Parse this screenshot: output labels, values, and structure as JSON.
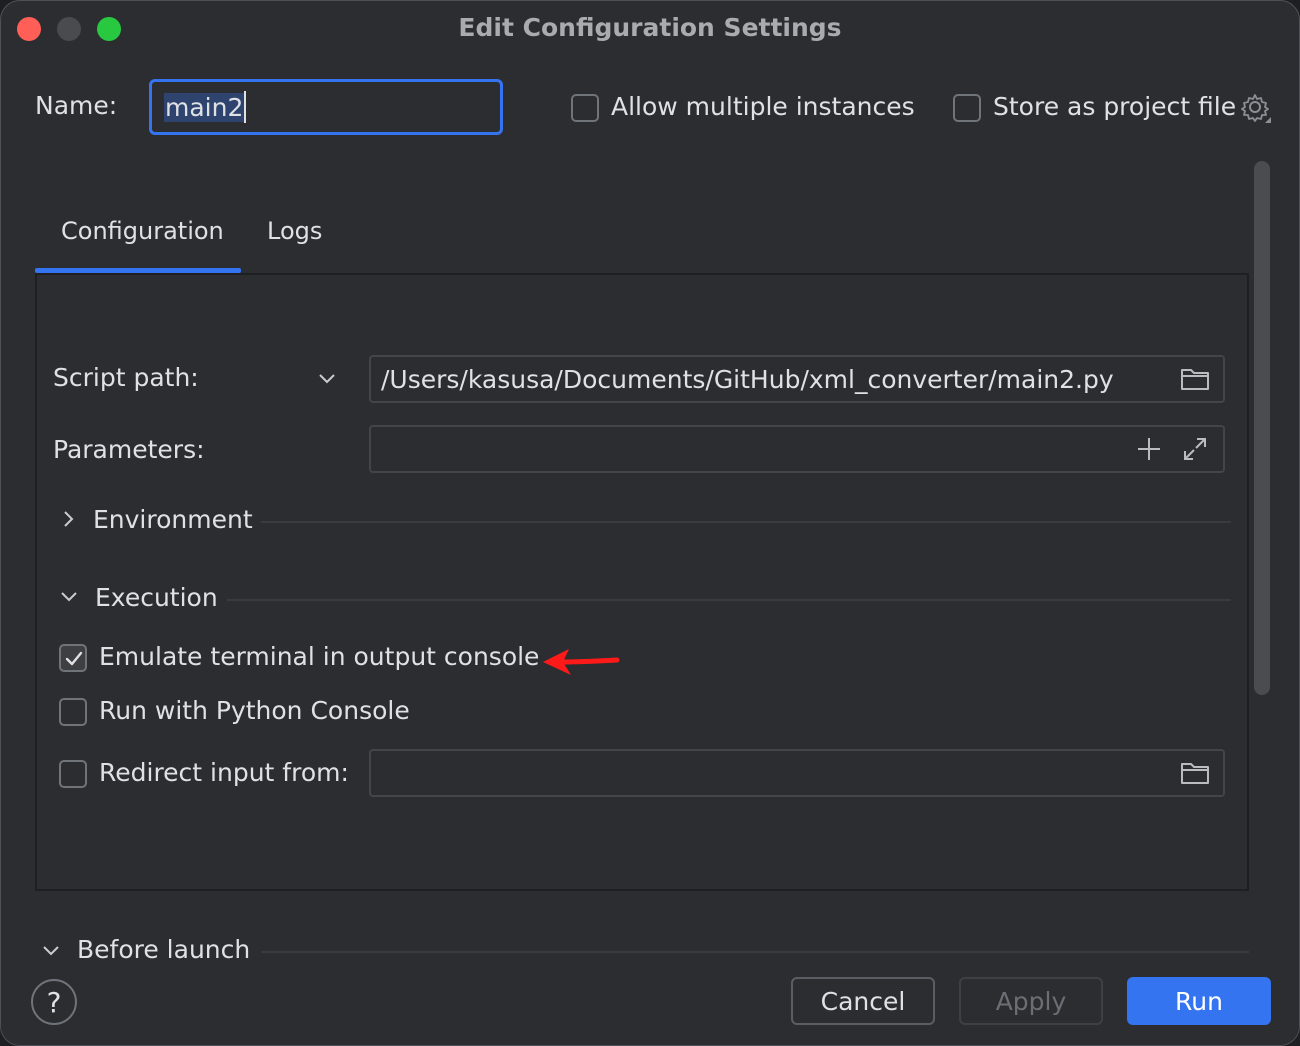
{
  "window": {
    "title": "Edit Configuration Settings"
  },
  "name_row": {
    "label": "Name:",
    "value": "main2",
    "allow_multiple_label": "Allow multiple instances",
    "allow_multiple_checked": false,
    "store_project_label": "Store as project file",
    "store_project_checked": false,
    "gear_icon": "gear-icon"
  },
  "tabs": [
    {
      "label": "Configuration",
      "active": true
    },
    {
      "label": "Logs",
      "active": false
    }
  ],
  "config": {
    "script_path_label": "Script path:",
    "script_path_value": "/Users/kasusa/Documents/GitHub/xml_converter/main2.py",
    "parameters_label": "Parameters:",
    "parameters_value": "",
    "environment_label": "Environment",
    "execution_label": "Execution",
    "emulate_terminal_label": "Emulate terminal in output console",
    "emulate_terminal_checked": true,
    "python_console_label": "Run with Python Console",
    "python_console_checked": false,
    "redirect_input_label": "Redirect input from:",
    "redirect_input_checked": false,
    "redirect_input_value": ""
  },
  "before_launch_label": "Before launch",
  "footer": {
    "help_label": "?",
    "cancel_label": "Cancel",
    "apply_label": "Apply",
    "apply_enabled": false,
    "run_label": "Run"
  },
  "colors": {
    "accent": "#3574f0",
    "annotation_arrow": "#ff1a1a",
    "background": "#2b2d30"
  }
}
